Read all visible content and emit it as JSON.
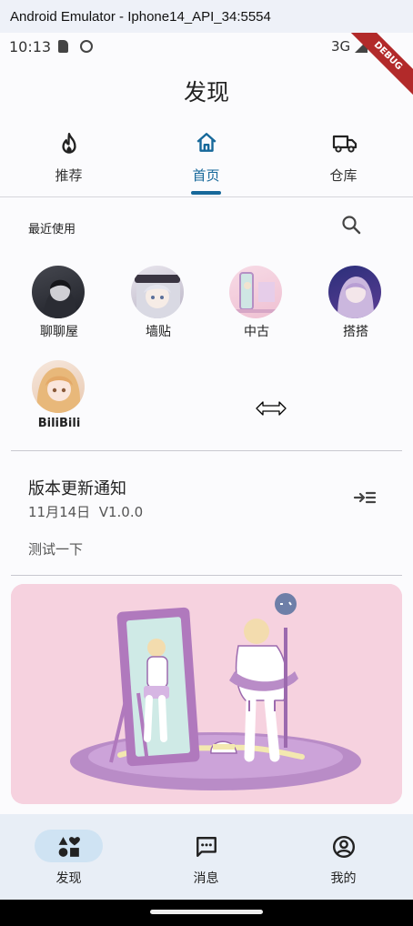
{
  "window": {
    "title": "Android Emulator - Iphone14_API_34:5554"
  },
  "status_bar": {
    "time": "10:13",
    "network": "3G",
    "debug_banner": "DEBUG"
  },
  "app_bar": {
    "title": "发现"
  },
  "tabs": [
    {
      "label": "推荐",
      "icon": "flame-icon",
      "active": false
    },
    {
      "label": "首页",
      "icon": "home-icon",
      "active": true
    },
    {
      "label": "仓库",
      "icon": "truck-icon",
      "active": false
    }
  ],
  "recent": {
    "label": "最近使用",
    "apps": [
      {
        "name": "聊聊屋",
        "avatar": "dark-portrait"
      },
      {
        "name": "墙贴",
        "avatar": "silver-hair-portrait"
      },
      {
        "name": "中古",
        "avatar": "pink-room-portrait"
      },
      {
        "name": "搭搭",
        "avatar": "purple-hair-portrait"
      },
      {
        "name": "BiliBili",
        "avatar": "blonde-girl-portrait"
      }
    ]
  },
  "notice": {
    "title": "版本更新通知",
    "date": "11月14日",
    "version": "V1.0.0",
    "body": "测试一下"
  },
  "banner": {
    "description": "illustration-mirror"
  },
  "bottom_nav": [
    {
      "label": "发现",
      "icon": "explore-shapes-icon",
      "active": true
    },
    {
      "label": "消息",
      "icon": "message-icon",
      "active": false
    },
    {
      "label": "我的",
      "icon": "account-icon",
      "active": false
    }
  ],
  "colors": {
    "accent": "#16689a",
    "nav_pill": "#cfe3f3",
    "nav_bg": "#e8eef6",
    "banner_bg": "#f6d2df"
  }
}
